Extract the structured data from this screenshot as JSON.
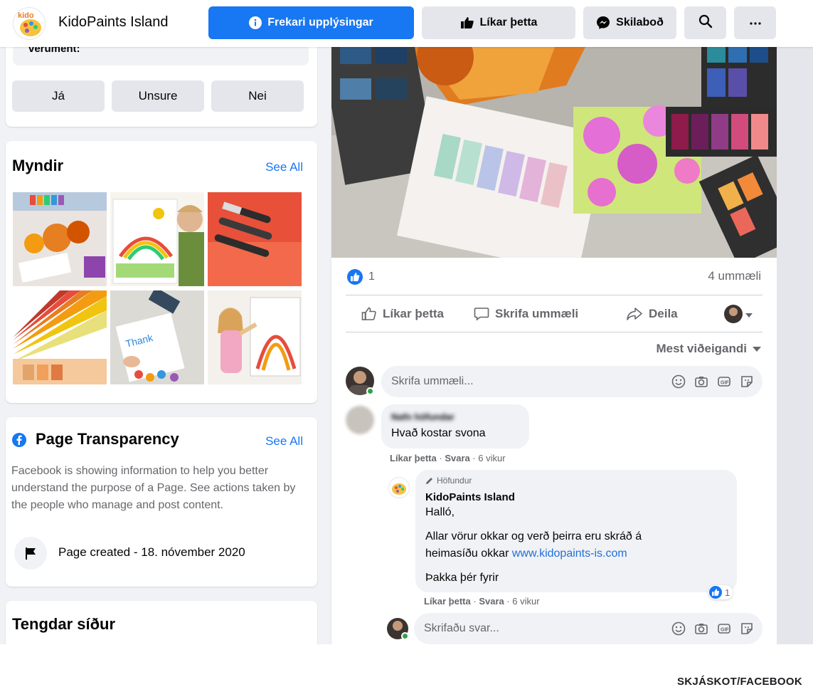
{
  "topbar": {
    "page_name": "KidoPaints Island",
    "info_button": "Frekari upplýsingar",
    "like_button": "Líkar þetta",
    "message_button": "Skilaboð",
    "logo_text": "kido"
  },
  "poll": {
    "truncated_text": "verument:",
    "options": [
      "Já",
      "Unsure",
      "Nei"
    ]
  },
  "photos": {
    "title": "Myndir",
    "see_all": "See All"
  },
  "transparency": {
    "title": "Page Transparency",
    "see_all": "See All",
    "description": "Facebook is showing information to help you better understand the purpose of a Page. See actions taken by the people who manage and post content.",
    "created": "Page created - 18. nóvember 2020"
  },
  "related": {
    "title": "Tengdar síður"
  },
  "post": {
    "reaction_count": "1",
    "comments_count": "4 ummæli",
    "actions": {
      "like": "Líkar þetta",
      "comment": "Skrifa ummæli",
      "share": "Deila"
    },
    "sort_label": "Mest viðeigandi",
    "comment_placeholder": "Skrifa ummæli...",
    "comment1": {
      "author_blurred": "Nafn höfundar",
      "text": "Hvað kostar svona",
      "like": "Líkar þetta",
      "reply": "Svara",
      "time": "6 vikur"
    },
    "reply1": {
      "badge": "Höfundur",
      "author": "KidoPaints Island",
      "line1": "Halló,",
      "line2a": "Allar vörur okkar og verð þeirra eru skráð á",
      "line2b": "heimasíðu okkar",
      "link": "www.kidopaints-is.com",
      "line3": "Þakka þér fyrir",
      "reaction_count": "1",
      "like": "Líkar þetta",
      "reply": "Svara",
      "time": "6 vikur"
    },
    "reply_placeholder": "Skrifaðu svar..."
  },
  "credit": "SKJÁSKOT/FACEBOOK",
  "colors": {
    "primary": "#1877f2",
    "background": "#f0f2f5",
    "secondary_text": "#65676b",
    "online": "#31a24c"
  }
}
